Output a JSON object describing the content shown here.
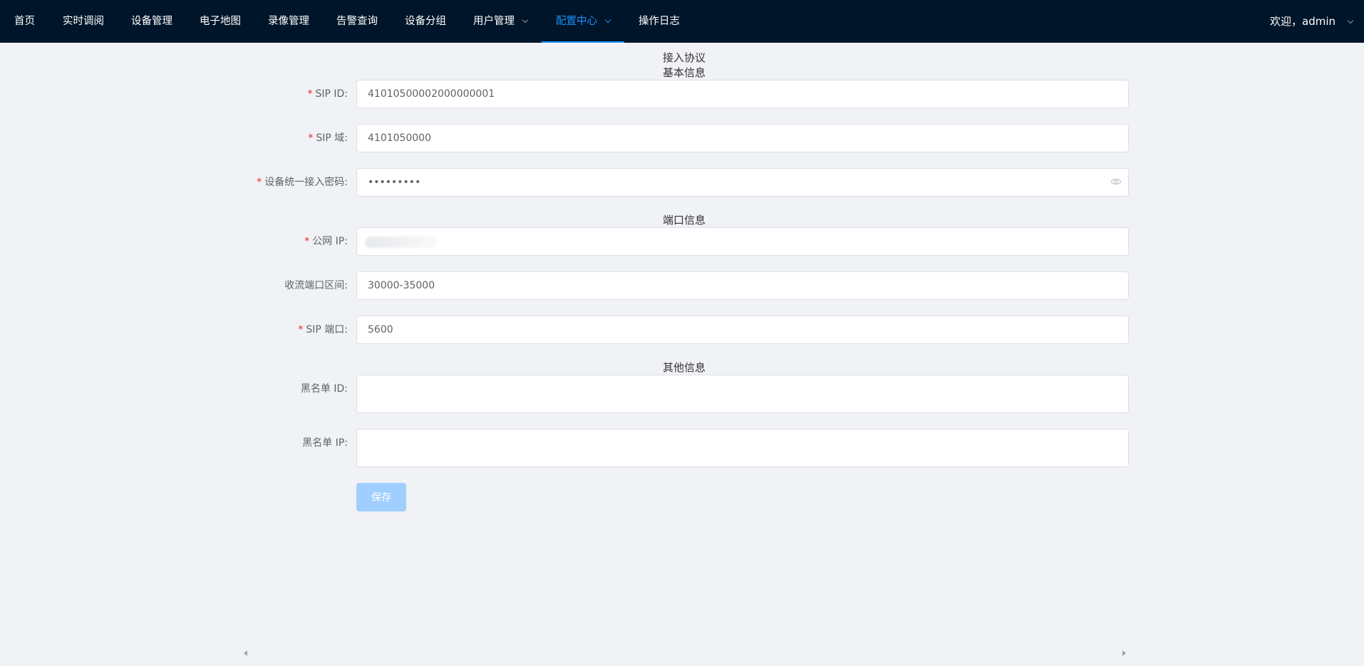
{
  "nav": {
    "items": [
      {
        "label": "首页",
        "dropdown": false,
        "active": false
      },
      {
        "label": "实时调阅",
        "dropdown": false,
        "active": false
      },
      {
        "label": "设备管理",
        "dropdown": false,
        "active": false
      },
      {
        "label": "电子地图",
        "dropdown": false,
        "active": false
      },
      {
        "label": "录像管理",
        "dropdown": false,
        "active": false
      },
      {
        "label": "告警查询",
        "dropdown": false,
        "active": false
      },
      {
        "label": "设备分组",
        "dropdown": false,
        "active": false
      },
      {
        "label": "用户管理",
        "dropdown": true,
        "active": false
      },
      {
        "label": "配置中心",
        "dropdown": true,
        "active": true
      },
      {
        "label": "操作日志",
        "dropdown": false,
        "active": false
      }
    ],
    "welcome": "欢迎，admin",
    "accent_color": "#1890ff",
    "bg_color": "#001529"
  },
  "form": {
    "title": "接入协议",
    "sections": {
      "basic": "基本信息",
      "port": "端口信息",
      "other": "其他信息"
    },
    "fields": {
      "sip_id": {
        "label": "SIP ID:",
        "value": "41010500002000000001",
        "required": true
      },
      "sip_domain": {
        "label": "SIP 域:",
        "value": "4101050000",
        "required": true
      },
      "password": {
        "label": "设备统一接入密码:",
        "value": "•••••••••",
        "required": true
      },
      "public_ip": {
        "label": "公网 IP:",
        "value": "",
        "required": true
      },
      "port_range": {
        "label": "收流端口区间:",
        "value": "30000-35000",
        "required": false
      },
      "sip_port": {
        "label": "SIP 端口:",
        "value": "5600",
        "required": true
      },
      "blacklist_id": {
        "label": "黑名单 ID:",
        "value": "",
        "required": false
      },
      "blacklist_ip": {
        "label": "黑名单 IP:",
        "value": "",
        "required": false
      }
    },
    "required_mark": "*",
    "save_label": "保存"
  }
}
